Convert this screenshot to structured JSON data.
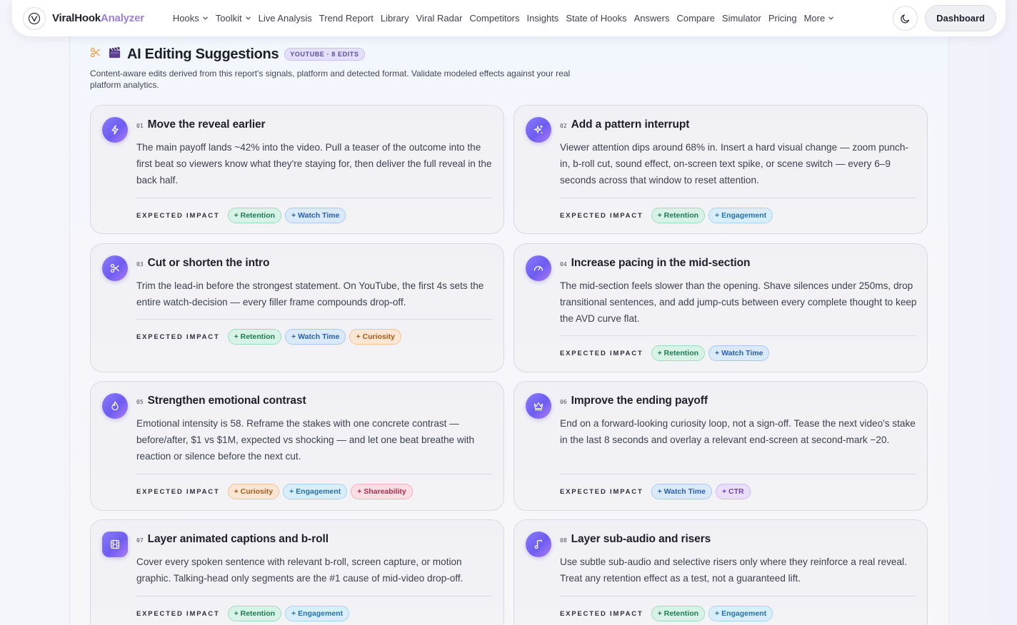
{
  "nav": {
    "brand_main": "ViralHook",
    "brand_accent": "Analyzer",
    "links": [
      {
        "label": "Hooks",
        "dropdown": true
      },
      {
        "label": "Toolkit",
        "dropdown": true
      },
      {
        "label": "Live Analysis",
        "dropdown": false
      },
      {
        "label": "Trend Report",
        "dropdown": false
      },
      {
        "label": "Library",
        "dropdown": false
      },
      {
        "label": "Viral Radar",
        "dropdown": false
      },
      {
        "label": "Competitors",
        "dropdown": false
      },
      {
        "label": "Insights",
        "dropdown": false
      },
      {
        "label": "State of Hooks",
        "dropdown": false
      },
      {
        "label": "Answers",
        "dropdown": false
      },
      {
        "label": "Compare",
        "dropdown": false
      },
      {
        "label": "Simulator",
        "dropdown": false
      },
      {
        "label": "Pricing",
        "dropdown": false
      },
      {
        "label": "More",
        "dropdown": true
      }
    ],
    "dashboard_label": "Dashboard"
  },
  "section": {
    "title": "AI Editing Suggestions",
    "badge": "YOUTUBE · 8 EDITS",
    "description": "Content-aware edits derived from this report's signals, platform and detected format. Validate modeled effects against your real platform analytics.",
    "impact_label": "EXPECTED IMPACT"
  },
  "cards": [
    {
      "num": "01",
      "title": "Move the reveal earlier",
      "icon": "lightning-icon",
      "body": "The main payoff lands ~42% into the video. Pull a teaser of the outcome into the first beat so viewers know what they're staying for, then deliver the full reveal in the back half.",
      "tags": [
        {
          "label": "+ Retention",
          "kind": "retention"
        },
        {
          "label": "+ Watch Time",
          "kind": "watch"
        }
      ]
    },
    {
      "num": "02",
      "title": "Add a pattern interrupt",
      "icon": "sparkles-icon",
      "body": "Viewer attention dips around 68% in. Insert a hard visual change — zoom punch-in, b-roll cut, sound effect, on-screen text spike, or scene switch — every 6–9 seconds across that window to reset attention.",
      "tags": [
        {
          "label": "+ Retention",
          "kind": "retention"
        },
        {
          "label": "+ Engagement",
          "kind": "engagement"
        }
      ]
    },
    {
      "num": "03",
      "title": "Cut or shorten the intro",
      "icon": "scissors-icon",
      "body": "Trim the lead-in before the strongest statement. On YouTube, the first 4s sets the entire watch-decision — every filler frame compounds drop-off.",
      "tags": [
        {
          "label": "+ Retention",
          "kind": "retention"
        },
        {
          "label": "+ Watch Time",
          "kind": "watch"
        },
        {
          "label": "+ Curiosity",
          "kind": "curiosity"
        }
      ]
    },
    {
      "num": "04",
      "title": "Increase pacing in the mid-section",
      "icon": "gauge-icon",
      "body": "The mid-section feels slower than the opening. Shave silences under 250ms, drop transitional sentences, and add jump-cuts between every complete thought to keep the AVD curve flat.",
      "tags": [
        {
          "label": "+ Retention",
          "kind": "retention"
        },
        {
          "label": "+ Watch Time",
          "kind": "watch"
        }
      ]
    },
    {
      "num": "05",
      "title": "Strengthen emotional contrast",
      "icon": "flame-icon",
      "body": "Emotional intensity is 58. Reframe the stakes with one concrete contrast — before/after, $1 vs $1M, expected vs shocking — and let one beat breathe with reaction or silence before the next cut.",
      "tags": [
        {
          "label": "+ Curiosity",
          "kind": "curiosity"
        },
        {
          "label": "+ Engagement",
          "kind": "engagement"
        },
        {
          "label": "+ Shareability",
          "kind": "shareability"
        }
      ]
    },
    {
      "num": "06",
      "title": "Improve the ending payoff",
      "icon": "crown-icon",
      "body": "End on a forward-looking curiosity loop, not a sign-off. Tease the next video's stake in the last 8 seconds and overlay a relevant end-screen at second-mark −20.",
      "tags": [
        {
          "label": "+ Watch Time",
          "kind": "watch"
        },
        {
          "label": "+ CTR",
          "kind": "ctr"
        }
      ]
    },
    {
      "num": "07",
      "title": "Layer animated captions and b-roll",
      "icon": "film-icon",
      "body": "Cover every spoken sentence with relevant b-roll, screen capture, or motion graphic. Talking-head only segments are the #1 cause of mid-video drop-off.",
      "tags": [
        {
          "label": "+ Retention",
          "kind": "retention"
        },
        {
          "label": "+ Engagement",
          "kind": "engagement"
        }
      ]
    },
    {
      "num": "08",
      "title": "Layer sub-audio and risers",
      "icon": "music-note-icon",
      "body": "Use subtle sub-audio and selective risers only where they reinforce a real reveal. Treat any retention effect as a test, not a guaranteed lift.",
      "tags": [
        {
          "label": "+ Retention",
          "kind": "retention"
        },
        {
          "label": "+ Engagement",
          "kind": "engagement"
        }
      ]
    }
  ]
}
